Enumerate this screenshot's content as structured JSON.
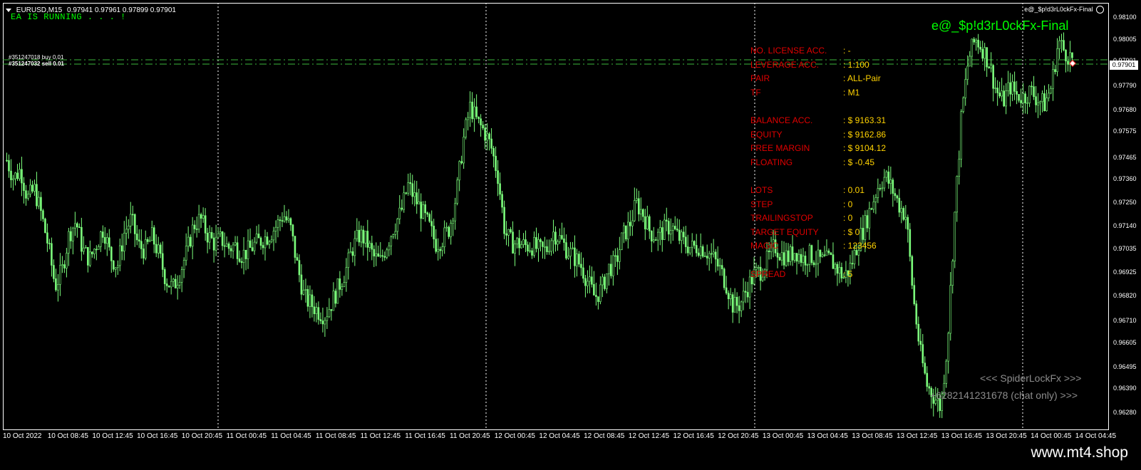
{
  "header": {
    "symbol": "EURUSD,M15",
    "ohlc": "0.97941 0.97961 0.97899 0.97901",
    "ea_status": "EA IS RUNNING . . . !",
    "ea_name_small": "e@_$p!d3rL0ckFx-Final",
    "smile_icon": "smiley-icon"
  },
  "ea_title": "e@_$p!d3rL0ckFx-Final",
  "info_panel": [
    {
      "label": "NO. LICENSE ACC.",
      "value": ": -"
    },
    {
      "label": "LEVERAGE ACC.",
      "value": ": 1:100"
    },
    {
      "label": "PAIR",
      "value": ": ALL-Pair"
    },
    {
      "label": "TF",
      "value": ": M1"
    },
    {
      "label": "",
      "value": ""
    },
    {
      "label": "BALANCE ACC.",
      "value": ": $ 9163.31"
    },
    {
      "label": "EQUITY",
      "value": ": $ 9162.86"
    },
    {
      "label": "FREE MARGIN",
      "value": ": $ 9104.12"
    },
    {
      "label": "FLOATING",
      "value": ": $ -0.45"
    },
    {
      "label": "",
      "value": ""
    },
    {
      "label": "LOTS",
      "value": ": 0.01"
    },
    {
      "label": "STEP",
      "value": ": 0"
    },
    {
      "label": "TRAILINGSTOP",
      "value": ": 0"
    },
    {
      "label": "TARGET EQUITY",
      "value": ": $ 0"
    },
    {
      "label": "MAGIC",
      "value": ": 123456"
    },
    {
      "label": "",
      "value": ""
    },
    {
      "label": "SPREAD",
      "value": ": 5"
    }
  ],
  "orders": {
    "buy_label": "#351247018 buy 0.01",
    "sell_label": "#351247032 sell 0.01"
  },
  "watermark": {
    "brand": "<<< SpiderLockFx >>>",
    "phone": "+6282141231678 (chat only) >>>"
  },
  "price_axis": {
    "ticks": [
      "0.98100",
      "0.98005",
      "0.97901",
      "0.97790",
      "0.97680",
      "0.97575",
      "0.97465",
      "0.97360",
      "0.97250",
      "0.97140",
      "0.97035",
      "0.96925",
      "0.96820",
      "0.96710",
      "0.96605",
      "0.96495",
      "0.96390",
      "0.96280"
    ],
    "current_price": "0.97901"
  },
  "time_axis": {
    "ticks": [
      "10 Oct 2022",
      "10 Oct 08:45",
      "10 Oct 12:45",
      "10 Oct 16:45",
      "10 Oct 20:45",
      "11 Oct 00:45",
      "11 Oct 04:45",
      "11 Oct 08:45",
      "11 Oct 12:45",
      "11 Oct 16:45",
      "11 Oct 20:45",
      "12 Oct 00:45",
      "12 Oct 04:45",
      "12 Oct 08:45",
      "12 Oct 12:45",
      "12 Oct 16:45",
      "12 Oct 20:45",
      "13 Oct 00:45",
      "13 Oct 04:45",
      "13 Oct 08:45",
      "13 Oct 12:45",
      "13 Oct 16:45",
      "13 Oct 20:45",
      "14 Oct 00:45",
      "14 Oct 04:45"
    ]
  },
  "chart_data": {
    "type": "candlestick",
    "symbol": "EURUSD",
    "timeframe": "M15",
    "ylim": [
      0.9625,
      0.9815
    ],
    "close_series": [
      0.9745,
      0.9737,
      0.9741,
      0.9728,
      0.9732,
      0.9721,
      0.9707,
      0.9689,
      0.9696,
      0.9712,
      0.9718,
      0.9705,
      0.9701,
      0.9708,
      0.9715,
      0.9702,
      0.9698,
      0.9713,
      0.9719,
      0.9707,
      0.9705,
      0.9711,
      0.9703,
      0.9692,
      0.9688,
      0.9695,
      0.9704,
      0.9716,
      0.9719,
      0.9712,
      0.9708,
      0.971,
      0.9706,
      0.9707,
      0.9703,
      0.9705,
      0.9708,
      0.971,
      0.9712,
      0.9716,
      0.9721,
      0.9715,
      0.9698,
      0.9684,
      0.9681,
      0.9678,
      0.9676,
      0.9682,
      0.9689,
      0.9696,
      0.9706,
      0.9712,
      0.9709,
      0.9702,
      0.97,
      0.9708,
      0.9716,
      0.9722,
      0.9734,
      0.9728,
      0.9722,
      0.9716,
      0.9708,
      0.971,
      0.9715,
      0.973,
      0.9754,
      0.9769,
      0.9762,
      0.9758,
      0.9751,
      0.9738,
      0.9713,
      0.9708,
      0.9708,
      0.9707,
      0.9707,
      0.9705,
      0.9705,
      0.9713,
      0.971,
      0.9705,
      0.9702,
      0.9698,
      0.9691,
      0.9684,
      0.9688,
      0.9697,
      0.9699,
      0.9711,
      0.9716,
      0.9726,
      0.9721,
      0.9713,
      0.9711,
      0.9714,
      0.9716,
      0.9711,
      0.9708,
      0.9706,
      0.9707,
      0.9705,
      0.9702,
      0.9697,
      0.969,
      0.968,
      0.9681,
      0.9688,
      0.9694,
      0.9696,
      0.9701,
      0.9707,
      0.9703,
      0.9702,
      0.9705,
      0.9701,
      0.9703,
      0.9701,
      0.97,
      0.9701,
      0.9697,
      0.9693,
      0.9698,
      0.9708,
      0.9716,
      0.9725,
      0.9734,
      0.9738,
      0.9732,
      0.9725,
      0.972,
      0.9685,
      0.966,
      0.9645,
      0.964,
      0.9635,
      0.9665,
      0.972,
      0.9765,
      0.979,
      0.9799,
      0.9795,
      0.9788,
      0.9776,
      0.9771,
      0.9778,
      0.9774,
      0.9773,
      0.9776,
      0.9772,
      0.977,
      0.9778,
      0.9798,
      0.9793,
      0.979
    ]
  },
  "colors": {
    "background": "#000000",
    "candle": "#7cff7c",
    "grid": "#ffffff",
    "label_red": "#e00000",
    "value_yellow": "#ffd200",
    "ea_green": "#00ff00",
    "watermark": "#8c8c8c"
  },
  "footer": {
    "site": "www.mt4.shop"
  }
}
